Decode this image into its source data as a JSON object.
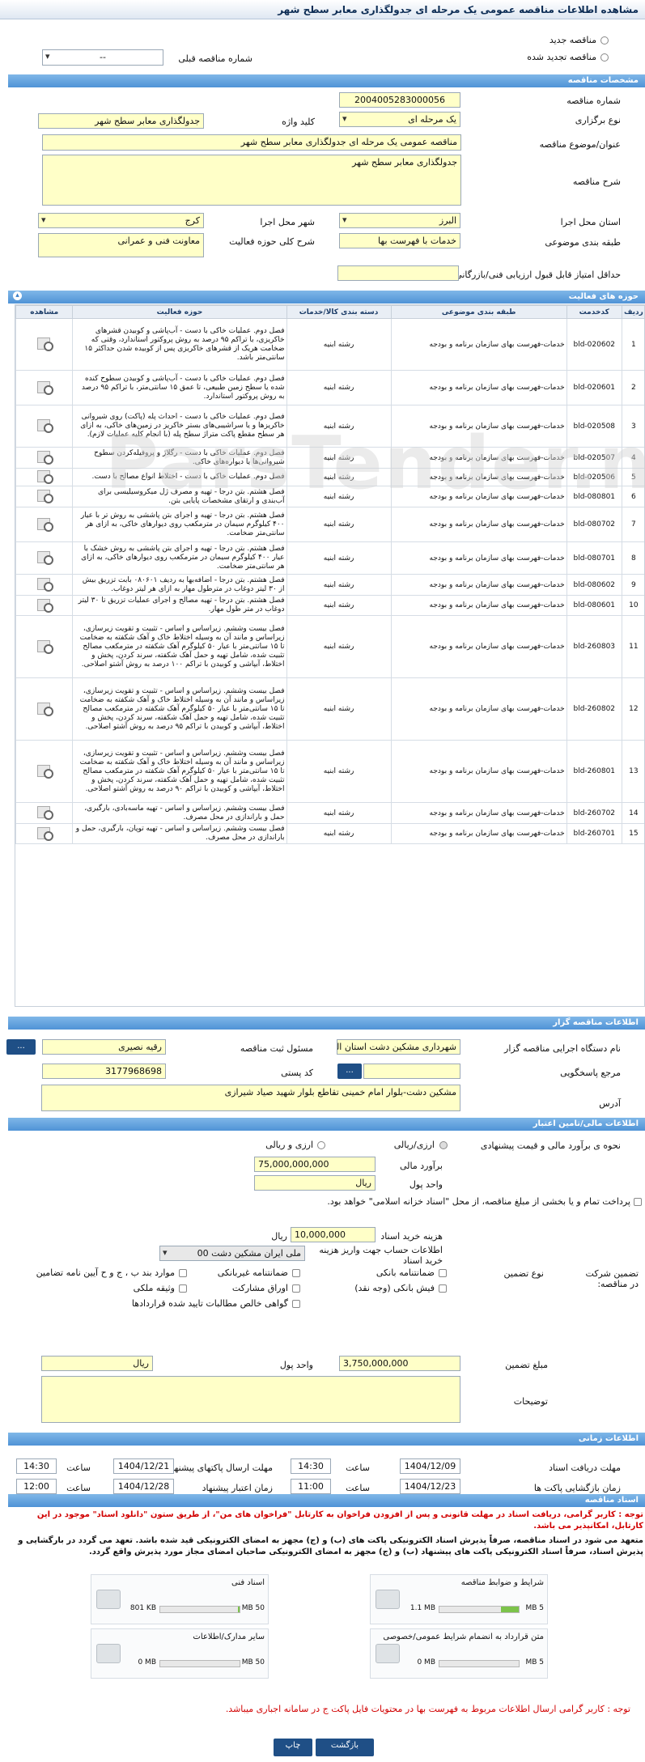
{
  "header": {
    "title": "مشاهده اطلاعات مناقصه عمومی یک مرحله ای جدولگذاری معابر سطح شهر"
  },
  "top": {
    "radio_new": "مناقصه جدید",
    "radio_renewed": "مناقصه تجدید شده",
    "prev_number_label": "شماره مناقصه قبلی",
    "prev_number_value": "--"
  },
  "spec": {
    "section": "مشخصات مناقصه",
    "number_label": "شماره مناقصه",
    "number_value": "2004005283000056",
    "holding_label": "نوع برگزاری",
    "holding_value": "یک مرحله ای",
    "keyword_label": "کلید واژه",
    "keyword_value": "جدولگذاری معابر سطح شهر",
    "subject_label": "عنوان/موضوع مناقصه",
    "subject_value": "مناقصه عمومی یک مرحله ای جدولگذاری معابر سطح شهر",
    "desc_label": "شرح مناقصه",
    "desc_value": "جدولگذاری معابر سطح شهر",
    "province_label": "استان محل اجرا",
    "province_value": "البرز",
    "city_label": "شهر محل اجرا",
    "city_value": "کرج",
    "category_label": "طبقه بندی موضوعی",
    "category_value": "خدمات با فهرست بها",
    "activity_label": "شرح کلی حوزه فعالیت",
    "activity_value": "معاونت فنی و عمرانی",
    "min_score_label": "حداقل امتیاز قابل قبول ارزیابی فنی/بازرگانی",
    "min_score_value": ""
  },
  "activities": {
    "section": "حوزه های فعالیت",
    "headers": [
      "ردیف",
      "کدخدمت",
      "طبقه بندی موضوعی",
      "دسته بندی کالا/خدمات",
      "حوزه فعالیت",
      "مشاهده"
    ],
    "rows": [
      {
        "n": "1",
        "code": "bld-020602",
        "cat": "خدمات-فهرست بهای سازمان برنامه و بودجه",
        "group": "رشته ابنیه",
        "desc": "فصل دوم. عملیات خاکی با دست - آب‌پاشی و کوبیدن قشرهای خاکریزی، با تراکم ۹۵ درصد به روش پروکتور استاندارد، وقتی که ضخامت هریک از قشرهای خاکریزی پس از کوبیده شدن حداکثر ۱۵ سانتی‌متر باشد."
      },
      {
        "n": "2",
        "code": "bld-020601",
        "cat": "خدمات-فهرست بهای سازمان برنامه و بودجه",
        "group": "رشته ابنیه",
        "desc": "فصل دوم. عملیات خاکی با دست - آب‌پاشی و کوبیدن سطوح کنده شده یا سطح زمین طبیعی، تا عمق ۱۵ سانتی‌متر، با تراکم ۹۵ درصد به روش پروکتور استاندارد."
      },
      {
        "n": "3",
        "code": "bld-020508",
        "cat": "خدمات-فهرست بهای سازمان برنامه و بودجه",
        "group": "رشته ابنیه",
        "desc": "فصل دوم. عملیات خاکی با دست - احداث پله (پاکت) روی شیروانی خاکریزها و یا سراشیبی‌های بستر خاکریز در زمین‌های خاکی، به ازای هر سطح مقطع پاکت متراژ سطح پله (با انجام کلیه عملیات لازم)."
      },
      {
        "n": "4",
        "code": "bld-020507",
        "cat": "خدمات-فهرست بهای سازمان برنامه و بودجه",
        "group": "رشته ابنیه",
        "desc": "فصل دوم. عملیات خاکی با دست - رگلاژ و پروفیله‌کردن سطوح شیروانی‌ها یا دیواره‌های خاکی."
      },
      {
        "n": "5",
        "code": "bld-020506",
        "cat": "خدمات-فهرست بهای سازمان برنامه و بودجه",
        "group": "رشته ابنیه",
        "desc": "فصل دوم. عملیات خاکی با دست - اختلاط انواع مصالح با دست."
      },
      {
        "n": "6",
        "code": "bld-080801",
        "cat": "خدمات-فهرست بهای سازمان برنامه و بودجه",
        "group": "رشته ابنیه",
        "desc": "فصل هشتم. بتن درجا - تهیه و مصرف ژل میکروسیلیسی برای آب‌بندی و ارتقای مشخصات پایایی بتن."
      },
      {
        "n": "7",
        "code": "bld-080702",
        "cat": "خدمات-فهرست بهای سازمان برنامه و بودجه",
        "group": "رشته ابنیه",
        "desc": "فصل هشتم. بتن درجا - تهیه و اجرای بتن پاششی به روش تر با عیار ۴۰۰ کیلوگرم سیمان در مترمکعب روی دیوارهای خاکی، به ازای هر سانتی‌متر ضخامت."
      },
      {
        "n": "8",
        "code": "bld-080701",
        "cat": "خدمات-فهرست بهای سازمان برنامه و بودجه",
        "group": "رشته ابنیه",
        "desc": "فصل هشتم. بتن درجا - تهیه و اجرای بتن پاششی به روش خشک با عیار ۴۰۰ کیلوگرم سیمان در مترمکعب روی دیوارهای خاکی، به ازای هر سانتی‌متر ضخامت."
      },
      {
        "n": "9",
        "code": "bld-080602",
        "cat": "خدمات-فهرست بهای سازمان برنامه و بودجه",
        "group": "رشته ابنیه",
        "desc": "فصل هشتم. بتن درجا - اضافه‌بها به ردیف ۰۸۰۶۰۱ بابت تزریق بیش از ۳۰ لیتر دوغاب در مترطول مهار به ازای هر لیتر دوغاب."
      },
      {
        "n": "10",
        "code": "bld-080601",
        "cat": "خدمات-فهرست بهای سازمان برنامه و بودجه",
        "group": "رشته ابنیه",
        "desc": "فصل هشتم. بتن درجا - تهیه مصالح و اجرای عملیات تزریق تا ۳۰ لیتر دوغاب در متر طول مهار."
      },
      {
        "n": "11",
        "code": "bld-260803",
        "cat": "خدمات-فهرست بهای سازمان برنامه و بودجه",
        "group": "رشته ابنیه",
        "desc": "فصل بیست وششم. زیراساس و اساس - تثبیت و تقویت زیرسازی، زیراساس و مانند آن به وسیله اختلاط خاک و آهک شکفته به ضخامت تا ۱۵ سانتی‌متر با عیار ۵۰ کیلوگرم آهک شکفته در مترمکعب مصالح تثبیت شده، شامل تهیه و حمل آهک شکفته، سرند کردن، پخش و اختلاط، آبپاشی و کوبیدن با تراکم ۱۰۰ درصد به روش آشتو اصلاحی."
      },
      {
        "n": "12",
        "code": "bld-260802",
        "cat": "خدمات-فهرست بهای سازمان برنامه و بودجه",
        "group": "رشته ابنیه",
        "desc": "فصل بیست وششم. زیراساس و اساس - تثبیت و تقویت زیرسازی، زیراساس و مانند آن به وسیله اختلاط خاک و آهک شکفته به ضخامت تا ۱۵ سانتی‌متر با عیار ۵۰ کیلوگرم آهک شکفته در مترمکعب مصالح تثبیت شده، شامل تهیه و حمل آهک شکفته، سرند کردن، پخش و اختلاط، آبپاشی و کوبیدن با تراکم ۹۵ درصد به روش آشتو اصلاحی."
      },
      {
        "n": "13",
        "code": "bld-260801",
        "cat": "خدمات-فهرست بهای سازمان برنامه و بودجه",
        "group": "رشته ابنیه",
        "desc": "فصل بیست وششم. زیراساس و اساس - تثبیت و تقویت زیرسازی، زیراساس و مانند آن به وسیله اختلاط خاک و آهک شکفته به ضخامت تا ۱۵ سانتی‌متر با عیار ۵۰ کیلوگرم آهک شکفته در مترمکعب مصالح تثبیت شده، شامل تهیه و حمل آهک شکفته، سرند کردن، پخش و اختلاط، آبپاشی و کوبیدن با تراکم ۹۰ درصد به روش آشتو اصلاحی."
      },
      {
        "n": "14",
        "code": "bld-260702",
        "cat": "خدمات-فهرست بهای سازمان برنامه و بودجه",
        "group": "رشته ابنیه",
        "desc": "فصل بیست وششم. زیراساس و اساس - تهیه ماسه‌بادی، بارگیری، حمل و باراندازی در محل مصرف."
      },
      {
        "n": "15",
        "code": "bld-260701",
        "cat": "خدمات-فهرست بهای سازمان برنامه و بودجه",
        "group": "رشته ابنیه",
        "desc": "فصل بیست وششم. زیراساس و اساس - تهیه توپان، بارگیری، حمل و باراندازی در محل مصرف."
      }
    ]
  },
  "organizer": {
    "section": "اطلاعات مناقصه گزار",
    "org_label": "نام دستگاه اجرایی مناقصه گزار",
    "org_value": "شهرداری مشکین دشت استان البرز",
    "resp_label": "مسئول ثبت مناقصه",
    "resp_value": "رقیه نصیری",
    "ref_label": "مرجع پاسخگویی",
    "ref_value": "",
    "postal_label": "کد پستی",
    "postal_value": "3177968698",
    "address_label": "آدرس",
    "address_value": "مشکین دشت-بلوار امام خمینی تقاطع بلوار شهید صیاد شیرازی",
    "dots": "..."
  },
  "finance": {
    "section": "اطلاعات مالی/تامین اعتبار",
    "estimate_type_label": "نحوه ی برآورد مالی و قیمت پیشنهادی",
    "opt_rial": "ارزی/ریالی",
    "opt_currency_rial": "ارزی و ریالی",
    "estimate_label": "برآورد مالی",
    "estimate_value": "75,000,000,000",
    "unit_label": "واحد پول",
    "unit_value": "ریال",
    "treasury_text": "پرداخت تمام و یا بخشی از مبلغ مناقصه، از محل \"اسناد خزانه اسلامی\" خواهد بود.",
    "purchase_fee_label": "هزینه خرید اسناد",
    "purchase_fee_value": "10,000,000",
    "purchase_fee_unit": "ریال",
    "account_label": "اطلاعات حساب جهت واریز هزینه خرید اسناد",
    "account_value": "ملی ایران مشکین دشت 00",
    "guarantee_type_label": "نوع تضمین",
    "participation_label": "تضمین شرکت در مناقصه:",
    "g1": "ضمانتنامه بانکی",
    "g2": "ضمانتنامه غیربانکی",
    "g3": "موارد بند ب ، ج و ح آیین نامه تضامین",
    "g4": "فیش بانکی (وجه نقد)",
    "g5": "اوراق مشارکت",
    "g6": "وثیقه ملکی",
    "g7": "گواهی خالص مطالبات تایید شده قراردادها",
    "amount_label": "مبلغ تضمین",
    "amount_value": "3,750,000,000",
    "amount_unit_label": "واحد پول",
    "amount_unit_value": "ریال",
    "notes_label": "توضیحات",
    "notes_value": ""
  },
  "timing": {
    "section": "اطلاعات زمانی",
    "doc_deadline_label": "مهلت دریافت اسناد",
    "doc_deadline_date": "1404/12/09",
    "doc_deadline_time": "14:30",
    "submit_deadline_label": "مهلت ارسال پاکتهای پیشنهادها",
    "submit_deadline_date": "1404/12/21",
    "submit_deadline_time": "14:30",
    "open_label": "زمان بازگشایی پاکت ها",
    "open_date": "1404/12/23",
    "open_time": "11:00",
    "validity_label": "زمان اعتبار پیشنهاد",
    "validity_date": "1404/12/28",
    "validity_time": "12:00",
    "time_label": "ساعت"
  },
  "docs": {
    "section": "اسناد مناقصه",
    "notice1": "توجه : کاربر گرامی، دریافت اسناد در مهلت قانونی و پس از افزودن فراخوان به کارتابل \"فراخوان های من\"، از طریق ستون \"دانلود اسناد\" موجود در این کارتابل، امکانپذیر می باشد.",
    "notice2": "متعهد می شود در اسناد مناقصه، صرفاً پذیرش اسناد الکترونیکی پاکت های (ب) و (ج) مجهز به امضای الکترونیکی قید شده باشد. تعهد می گردد در بارگشایی و پذیرش اسناد، صرفاً اسناد الکترونیکی پاکت های پیشنهاد (ب) و (ج) مجهز به امضای الکترونیکی صاحبان امضای مجاز مورد پذیرش واقع گردد.",
    "files": [
      {
        "title": "شرایط و ضوابط مناقصه",
        "used": "1.1 MB",
        "max": "5 MB",
        "fill": 0.22
      },
      {
        "title": "اسناد فنی",
        "used": "801 KB",
        "max": "50 MB",
        "fill": 0.02
      },
      {
        "title": "متن قرارداد به انضمام شرایط عمومی/خصوصی",
        "used": "0 MB",
        "max": "5 MB",
        "fill": 0
      },
      {
        "title": "سایر مدارک/اطلاعات",
        "used": "0 MB",
        "max": "50 MB",
        "fill": 0
      }
    ],
    "bottom_note": "توجه : کاربر گرامی ارسال اطلاعات مربوط به فهرست بها در محتویات فایل پاکت ج در سامانه اجباری میباشد."
  },
  "footer": {
    "print": "چاپ",
    "back": "بازگشت"
  }
}
